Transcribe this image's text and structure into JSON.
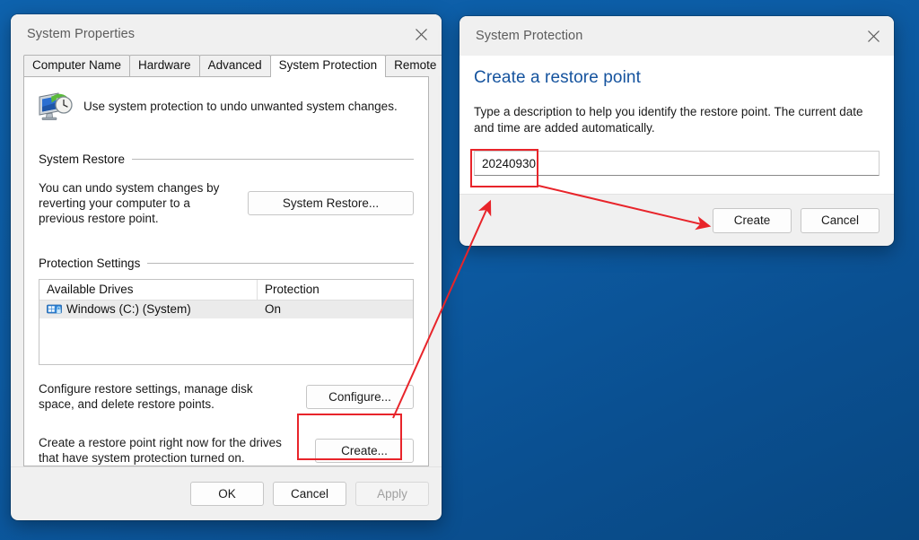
{
  "desktop": {
    "background_color": "#0b5596"
  },
  "system_properties": {
    "title": "System Properties",
    "close_label": "Close",
    "tabs": [
      {
        "label": "Computer Name",
        "active": false
      },
      {
        "label": "Hardware",
        "active": false
      },
      {
        "label": "Advanced",
        "active": false
      },
      {
        "label": "System Protection",
        "active": true
      },
      {
        "label": "Remote",
        "active": false
      }
    ],
    "intro_text": "Use system protection to undo unwanted system changes.",
    "intro_icon": "system-restore-icon",
    "system_restore": {
      "group_label": "System Restore",
      "description": "You can undo system changes by reverting your computer to a previous restore point.",
      "button_label": "System Restore..."
    },
    "protection_settings": {
      "group_label": "Protection Settings",
      "columns": [
        "Available Drives",
        "Protection"
      ],
      "rows": [
        {
          "drive": "Windows (C:) (System)",
          "protection": "On",
          "icon": "windows-drive-icon",
          "selected": true
        }
      ],
      "configure": {
        "description": "Configure restore settings, manage disk space, and delete restore points.",
        "button_label": "Configure..."
      },
      "create": {
        "description": "Create a restore point right now for the drives that have system protection turned on.",
        "button_label": "Create..."
      }
    },
    "footer": {
      "ok_label": "OK",
      "cancel_label": "Cancel",
      "apply_label": "Apply",
      "apply_disabled": true
    }
  },
  "system_protection": {
    "title": "System Protection",
    "close_label": "Close",
    "heading": "Create a restore point",
    "heading_color": "#15539e",
    "explanation": "Type a description to help you identify the restore point. The current date and time are added automatically.",
    "description_input": {
      "value": "20240930",
      "placeholder": ""
    },
    "footer": {
      "create_label": "Create",
      "cancel_label": "Cancel"
    }
  },
  "annotations": {
    "color": "#e8242a",
    "highlight_boxes": [
      {
        "name": "create-button-highlight",
        "target": "Create..."
      },
      {
        "name": "description-input-highlight",
        "target": "20240930"
      }
    ],
    "arrows": [
      {
        "name": "create-button-to-input-arrow",
        "from": "Create... button",
        "to": "restore point description field"
      },
      {
        "name": "input-to-create-arrow",
        "from": "restore point description field",
        "to": "Create button"
      }
    ]
  }
}
